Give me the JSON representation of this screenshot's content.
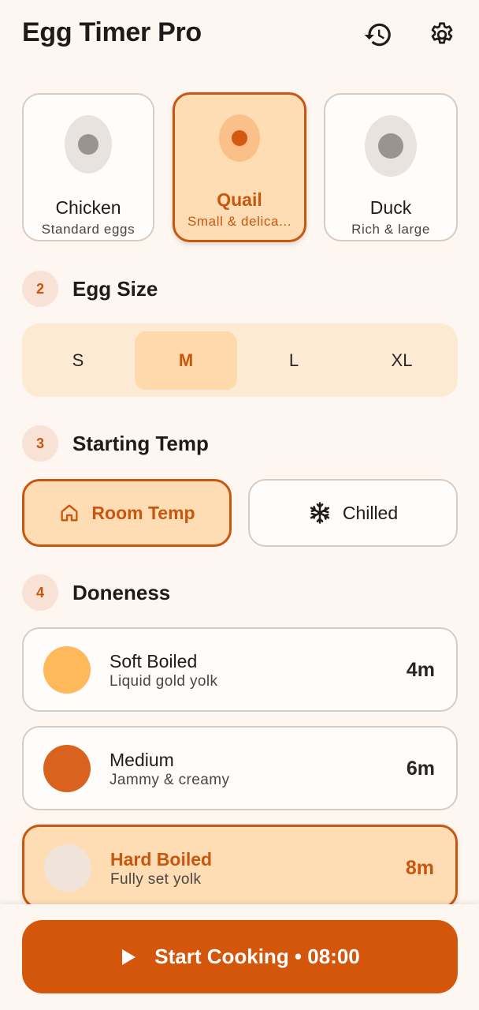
{
  "app": {
    "title": "Egg Timer Pro"
  },
  "header": {
    "history_icon": "history-icon",
    "settings_icon": "gear-icon"
  },
  "egg_types": [
    {
      "name": "Chicken",
      "subtitle": "Standard eggs",
      "selected": false
    },
    {
      "name": "Quail",
      "subtitle": "Small & delica...",
      "selected": true
    },
    {
      "name": "Duck",
      "subtitle": "Rich & large",
      "selected": false
    }
  ],
  "sections": {
    "size": {
      "step": "2",
      "label": "Egg Size"
    },
    "temp": {
      "step": "3",
      "label": "Starting Temp"
    },
    "doneness": {
      "step": "4",
      "label": "Doneness"
    }
  },
  "sizes": [
    {
      "label": "S",
      "selected": false
    },
    {
      "label": "M",
      "selected": true
    },
    {
      "label": "L",
      "selected": false
    },
    {
      "label": "XL",
      "selected": false
    }
  ],
  "temps": [
    {
      "label": "Room Temp",
      "icon": "home-icon",
      "selected": true
    },
    {
      "label": "Chilled",
      "icon": "snowflake-icon",
      "selected": false
    }
  ],
  "doneness": [
    {
      "title": "Soft Boiled",
      "subtitle": "Liquid gold yolk",
      "time": "4m",
      "color": "#FFB95A",
      "selected": false
    },
    {
      "title": "Medium",
      "subtitle": "Jammy & creamy",
      "time": "6m",
      "color": "#D9631E",
      "selected": false
    },
    {
      "title": "Hard Boiled",
      "subtitle": "Fully set yolk",
      "time": "8m",
      "color": "#F0E3DA",
      "selected": true
    }
  ],
  "start_button": {
    "label": "Start Cooking • 08:00",
    "icon": "play-icon"
  },
  "colors": {
    "accent": "#C8560F",
    "button": "#D3560B",
    "selected_bg": "#FEDDB5",
    "background": "#FDF6F1"
  }
}
